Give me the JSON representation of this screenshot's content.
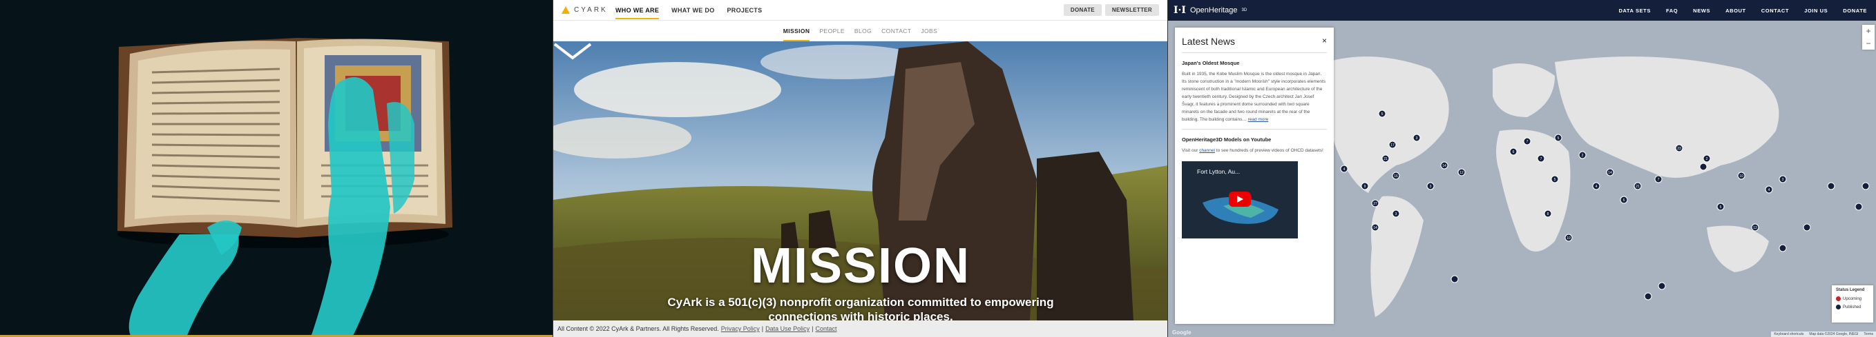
{
  "cyark": {
    "logo": "CYARK",
    "nav": [
      "WHO WE ARE",
      "WHAT WE DO",
      "PROJECTS"
    ],
    "buttons": {
      "donate": "DONATE",
      "newsletter": "NEWSLETTER"
    },
    "subnav": [
      "MISSION",
      "PEOPLE",
      "BLOG",
      "CONTACT",
      "JOBS"
    ],
    "hero_title": "MISSION",
    "hero_text": "CyArk is a 501(c)(3) nonprofit organization committed to empowering connections with historic places.",
    "footer": {
      "copyright": "All Content © 2022 CyArk & Partners. All Rights Reserved.",
      "links": [
        "Privacy Policy",
        "Data Use Policy",
        "Contact"
      ],
      "separator": "|"
    },
    "accent_color": "#f2b100"
  },
  "openheritage": {
    "logo": "OpenHeritage",
    "logo_sup": "3D",
    "nav": [
      "DATA SETS",
      "FAQ",
      "NEWS",
      "ABOUT",
      "CONTACT",
      "JOIN US",
      "DONATE"
    ],
    "news_panel": {
      "title": "Latest News",
      "close": "×",
      "articles": [
        {
          "title": "Japan's Oldest Mosque",
          "body": "Built in 1935, the Kobe Muslim Mosque is the oldest mosque in Japan. Its stone construction in a \"modern Moorish\" style incorporates elements reminiscent of both traditional Islamic and European architecture of the early twentieth century. Designed by the Czech architect Jan Josef Švagr, it features a prominent dome surrounded with two square minarets on the facade and two round minarets at the rear of the building. The building contains…",
          "read_more": "read more"
        },
        {
          "title": "OpenHeritage3D Models on Youtube",
          "body_prefix": "Visit our",
          "link": "channel",
          "body_suffix": "to see hundreds of preview videos of OHCD datasets!",
          "video_title": "Fort Lytton, Au..."
        }
      ]
    },
    "legend": {
      "title": "Status Legend",
      "items": [
        {
          "label": "Upcoming",
          "color": "#c0282d"
        },
        {
          "label": "Published",
          "color": "#14203b"
        }
      ]
    },
    "zoom": {
      "in": "+",
      "out": "−"
    },
    "attribution": [
      "Keyboard shortcuts",
      "Map data ©2024 Google, INEGI",
      "Terms"
    ],
    "google": "Google",
    "marker_labels": [
      "5",
      "17",
      "3",
      "14",
      "16",
      "3",
      "21",
      "4",
      "9",
      "27",
      "14",
      "3",
      "12",
      "6",
      "7",
      "7",
      "5",
      "8",
      "10",
      "5",
      "2",
      "4",
      "14",
      "6",
      "21",
      "7",
      "23",
      "2",
      "5",
      "10",
      "12",
      "4",
      "3"
    ]
  }
}
